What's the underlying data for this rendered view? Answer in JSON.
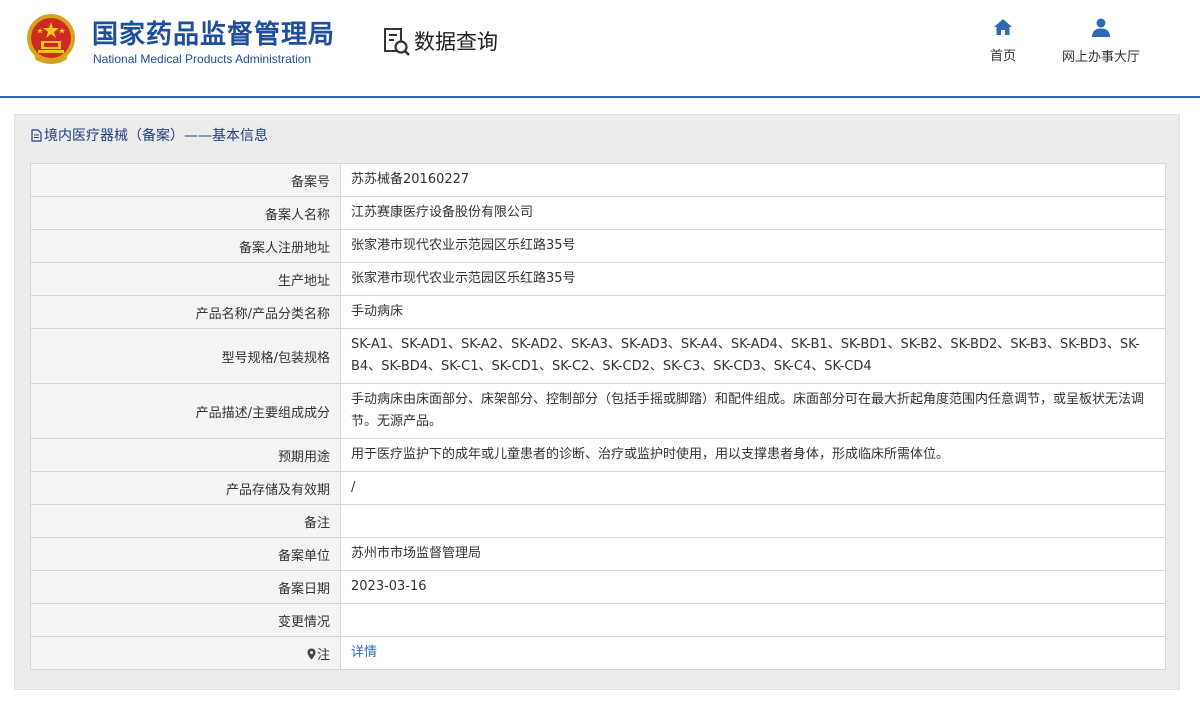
{
  "header": {
    "org_name_cn": "国家药品监督管理局",
    "org_name_en": "National Medical Products Administration",
    "query_label": "数据查询",
    "nav": [
      {
        "label": "首页",
        "icon": "home-icon"
      },
      {
        "label": "网上办事大厅",
        "icon": "user-icon"
      }
    ]
  },
  "panel": {
    "title": "境内医疗器械（备案）——基本信息"
  },
  "rows": [
    {
      "label": "备案号",
      "value": "苏苏械备20160227"
    },
    {
      "label": "备案人名称",
      "value": "江苏赛康医疗设备股份有限公司"
    },
    {
      "label": "备案人注册地址",
      "value": "张家港市现代农业示范园区乐红路35号"
    },
    {
      "label": "生产地址",
      "value": "张家港市现代农业示范园区乐红路35号"
    },
    {
      "label": "产品名称/产品分类名称",
      "value": "手动病床"
    },
    {
      "label": "型号规格/包装规格",
      "value": "SK-A1、SK-AD1、SK-A2、SK-AD2、SK-A3、SK-AD3、SK-A4、SK-AD4、SK-B1、SK-BD1、SK-B2、SK-BD2、SK-B3、SK-BD3、SK-B4、SK-BD4、SK-C1、SK-CD1、SK-C2、SK-CD2、SK-C3、SK-CD3、SK-C4、SK-CD4"
    },
    {
      "label": "产品描述/主要组成成分",
      "value": "手动病床由床面部分、床架部分、控制部分（包括手摇或脚踏）和配件组成。床面部分可在最大折起角度范围内任意调节，或呈板状无法调节。无源产品。"
    },
    {
      "label": "预期用途",
      "value": "用于医疗监护下的成年或儿童患者的诊断、治疗或监护时使用，用以支撑患者身体，形成临床所需体位。"
    },
    {
      "label": "产品存储及有效期",
      "value": "/"
    },
    {
      "label": "备注",
      "value": ""
    },
    {
      "label": "备案单位",
      "value": "苏州市市场监督管理局"
    },
    {
      "label": "备案日期",
      "value": "2023-03-16"
    },
    {
      "label": "变更情况",
      "value": ""
    },
    {
      "label": "注",
      "value": "详情"
    }
  ],
  "colors": {
    "brand": "#1f4e9c",
    "accent": "#2f6bb5",
    "label_bg": "#f4f4f4",
    "panel_bg": "#ececec"
  }
}
